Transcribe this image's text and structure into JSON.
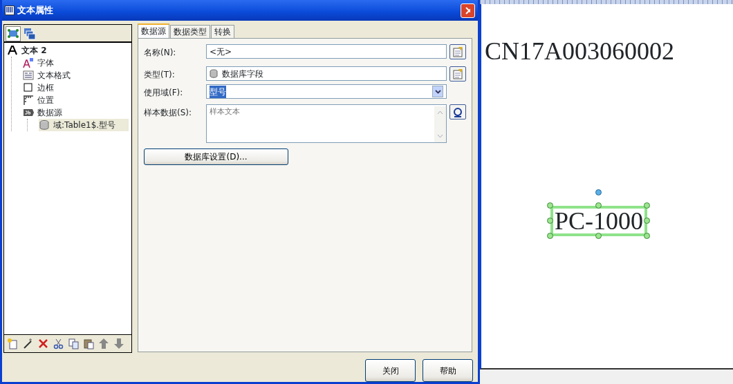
{
  "window": {
    "title": "文本属性"
  },
  "left_panel": {
    "view_buttons": [
      {
        "kind": "objects",
        "selected": true
      },
      {
        "kind": "layers",
        "selected": false
      }
    ],
    "tree": [
      {
        "label": "文本 2",
        "kind": "text",
        "selected": false,
        "children": [
          {
            "label": "字体",
            "kind": "font",
            "selected": false
          },
          {
            "label": "文本格式",
            "kind": "format",
            "selected": false
          },
          {
            "label": "边框",
            "kind": "border",
            "selected": false
          },
          {
            "label": "位置",
            "kind": "position",
            "selected": false
          },
          {
            "label": "数据源",
            "kind": "datasource",
            "selected": false,
            "children": [
              {
                "label": "域:Table1$.型号",
                "kind": "field",
                "selected": true
              }
            ]
          }
        ]
      }
    ]
  },
  "tabs": [
    {
      "label": "数据源",
      "selected": true
    },
    {
      "label": "数据类型",
      "selected": false
    },
    {
      "label": "转换",
      "selected": false
    }
  ],
  "fields": [
    {
      "kind": "text",
      "label": "名称(N):",
      "value": "<无>"
    },
    {
      "kind": "dbtext",
      "label": "类型(T):",
      "value": "数据库字段"
    },
    {
      "kind": "dropdown",
      "label": "使用域(F):",
      "value": "型号"
    },
    {
      "kind": "textarea",
      "label": "样本数据(S):",
      "value": "样本文本"
    }
  ],
  "settings_button": "数据库设置(D)...",
  "footer_buttons": [
    "关闭",
    "帮助"
  ],
  "canvas": {
    "objects": [
      {
        "text": "CN17A003060002",
        "selected": false
      },
      {
        "text": "PC-1000",
        "selected": true
      }
    ]
  }
}
